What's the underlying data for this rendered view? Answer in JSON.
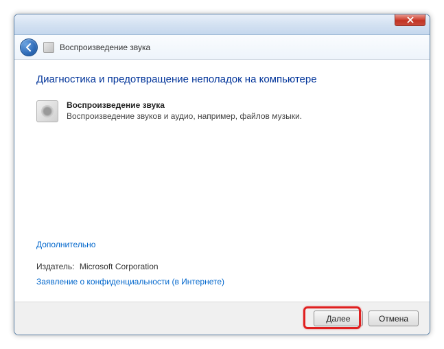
{
  "window": {
    "title": "Воспроизведение звука"
  },
  "heading": "Диагностика и предотвращение неполадок на компьютере",
  "troubleshooter": {
    "title": "Воспроизведение звука",
    "description": "Воспроизведение звуков и аудио, например, файлов музыки."
  },
  "links": {
    "advanced": "Дополнительно",
    "privacy": "Заявление о конфиденциальности (в Интернете)"
  },
  "publisher": {
    "label": "Издатель:",
    "value": "Microsoft Corporation"
  },
  "buttons": {
    "next": "Далее",
    "cancel": "Отмена"
  }
}
